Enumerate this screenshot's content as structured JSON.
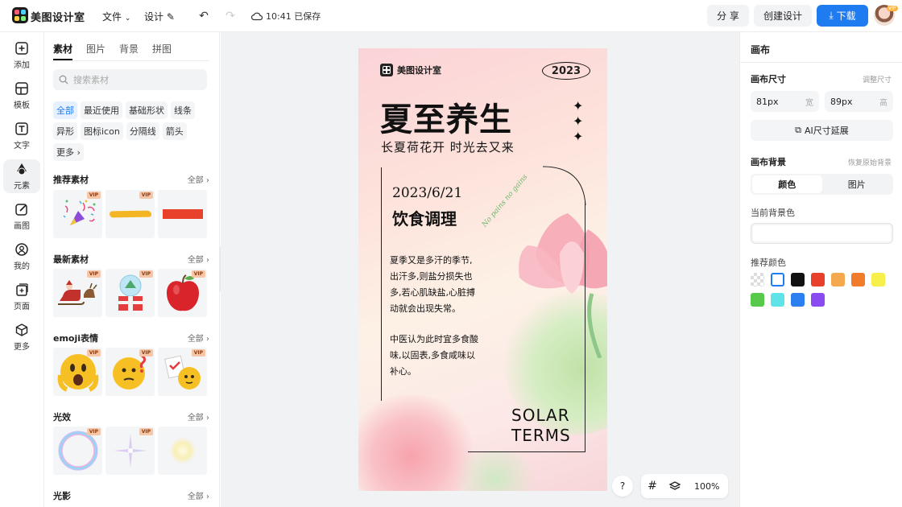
{
  "header": {
    "app_name": "美图设计室",
    "menu_file": "文件",
    "menu_design": "设计",
    "save_status": "10:41 已保存",
    "share_label": "分 享",
    "create_label": "创建设计",
    "download_label": "下载",
    "avatar_badge": "VIP",
    "accent_color": "#1e7bf0"
  },
  "rail": {
    "items": [
      {
        "label": "添加",
        "icon": "plus-square-icon"
      },
      {
        "label": "模板",
        "icon": "template-icon"
      },
      {
        "label": "文字",
        "icon": "text-icon"
      },
      {
        "label": "元素",
        "icon": "shapes-icon"
      },
      {
        "label": "画图",
        "icon": "pen-edit-icon"
      },
      {
        "label": "我的",
        "icon": "user-icon"
      },
      {
        "label": "页面",
        "icon": "add-page-icon"
      },
      {
        "label": "更多",
        "icon": "cube-icon"
      }
    ]
  },
  "panel": {
    "tabs": [
      "素材",
      "图片",
      "背景",
      "拼图"
    ],
    "search_placeholder": "搜索素材",
    "chips": [
      "全部",
      "最近使用",
      "基础形状",
      "线条",
      "异形",
      "图标icon",
      "分隔线",
      "箭头",
      "更多 ›"
    ],
    "all_label": "全部",
    "vip": "VIP",
    "sections": [
      {
        "title": "推荐素材",
        "items": [
          "party-popper-sticker",
          "yellow-brush-stroke",
          "red-bar"
        ]
      },
      {
        "title": "最新素材",
        "items": [
          "santa-sleigh-sticker",
          "snow-globe-gift",
          "red-apple"
        ]
      },
      {
        "title": "emoji表情",
        "items": [
          "shocked-emoji",
          "thinking-emoji",
          "checklist-emoji"
        ]
      },
      {
        "title": "光效",
        "items": [
          "rainbow-ring",
          "sparkle-star",
          "glow-dot"
        ]
      },
      {
        "title": "光影",
        "items": []
      }
    ]
  },
  "poster": {
    "brand": "美图设计室",
    "year": "2023",
    "title": "夏至养生",
    "subtitle": "长夏荷花开 时光去又来",
    "date": "2023/6/21",
    "heading": "饮食调理",
    "para1": [
      "夏季又是多汗的季节,",
      "出汗多,则盐分损失也",
      "多,若心肌缺盐,心脏搏",
      "动就会出现失常。"
    ],
    "para2": [
      "中医认为此时宜多食酸",
      "味,以固表,多食咸味以",
      "补心。"
    ],
    "footer_en": [
      "SOLAR",
      "TERMS"
    ],
    "script_text": "No pains no gains"
  },
  "right": {
    "title": "画布",
    "size_label": "画布尺寸",
    "resize_hint": "调整尺寸",
    "width_value": "81px",
    "width_unit": "宽",
    "height_value": "89px",
    "height_unit": "高",
    "ai_button": "AI尺寸延展",
    "bg_label": "画布背景",
    "restore_hint": "恢复原始背景",
    "seg_color": "颜色",
    "seg_image": "图片",
    "current_bg_label": "当前背景色",
    "recommend_label": "推荐颜色",
    "swatches": [
      "transparent",
      "#ffffff",
      "#111111",
      "#e8412b",
      "#f4a94f",
      "#f07b2b",
      "#f7f04a",
      "#57c94b",
      "#5de3e8",
      "#2b7ff0",
      "#8a4bf0"
    ]
  },
  "bottom": {
    "help": "?",
    "zoom": "100%"
  }
}
